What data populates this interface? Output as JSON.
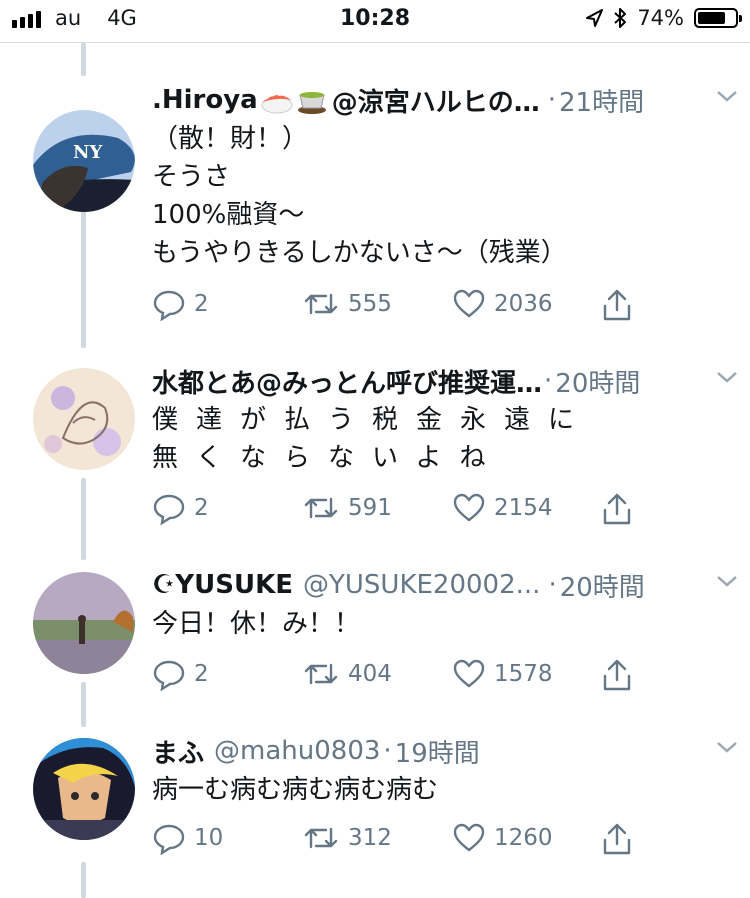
{
  "status_bar": {
    "carrier": "au",
    "network": "4G",
    "time": "10:28",
    "battery": "74%",
    "battery_level": 0.74
  },
  "tweets": [
    {
      "name": ".Hiroya",
      "handle": "@涼宮ハルヒの…",
      "time": "21時間",
      "lines": [
        "（散！財！）",
        "そうさ",
        "100%融資〜",
        "もうやりきるしかないさ〜（残業）"
      ],
      "replies": "2",
      "retweets": "555",
      "likes": "2036"
    },
    {
      "name": "水都とあ@みっとん呼び推奨運…",
      "handle": "",
      "time": "20時間",
      "lines": [
        "僕達が払う税金永遠に",
        "無くならないよね"
      ],
      "replies": "2",
      "retweets": "591",
      "likes": "2154"
    },
    {
      "name": "☪YUSUKE",
      "handle": "@YUSUKE20002...",
      "time": "20時間",
      "lines": [
        "今日！休！み！！"
      ],
      "replies": "2",
      "retweets": "404",
      "likes": "1578"
    },
    {
      "name": "まふ",
      "handle": "@mahu0803",
      "time": "19時間",
      "lines": [
        "病一む病む病む病む病む"
      ],
      "replies": "10",
      "retweets": "312",
      "likes": "1260"
    }
  ],
  "colors": {
    "text": "#14171a",
    "secondary": "#657786",
    "thread_line": "#cfd9de",
    "divider": "#dcdcdc"
  },
  "icons": [
    "signal-icon",
    "location-arrow-icon",
    "bluetooth-icon",
    "battery-icon",
    "sushi-emoji-icon",
    "tea-emoji-icon",
    "chevron-down-icon",
    "reply-icon",
    "retweet-icon",
    "like-icon",
    "share-icon"
  ]
}
